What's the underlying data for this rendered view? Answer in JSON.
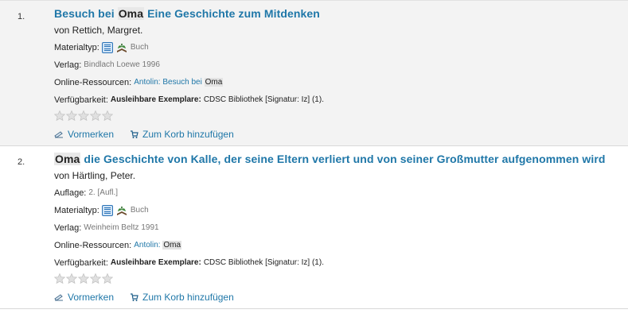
{
  "results": [
    {
      "number": "1.",
      "title_pre": "Besuch bei ",
      "title_hl": "Oma",
      "title_post": " Eine Geschichte zum Mitdenken",
      "author": "von Rettich, Margret.",
      "material_label": "Materialtyp:",
      "material_value": "Buch",
      "publisher_label": "Verlag:",
      "publisher_value": "Bindlach Loewe 1996",
      "online_label": "Online-Ressourcen:",
      "online_link": "Antolin: Besuch bei",
      "online_hl": "Oma",
      "avail_label": "Verfügbarkeit:",
      "avail_bold": "Ausleihbare Exemplare:",
      "avail_value": "CDSC Bibliothek [Signatur: Iz] (1).",
      "reserve_label": "Vormerken",
      "cart_label": "Zum Korb hinzufügen"
    },
    {
      "number": "2.",
      "title_hl": "Oma",
      "title_post": " die Geschichte von Kalle, der seine Eltern verliert und von seiner Großmutter aufgenommen wird",
      "author": "von Härtling, Peter.",
      "edition_label": "Auflage:",
      "edition_value": "2. [Aufl.]",
      "material_label": "Materialtyp:",
      "material_value": "Buch",
      "publisher_label": "Verlag:",
      "publisher_value": "Weinheim Beltz 1991",
      "online_label": "Online-Ressourcen:",
      "online_link": "Antolin:",
      "online_hl": "Oma",
      "avail_label": "Verfügbarkeit:",
      "avail_bold": "Ausleihbare Exemplare:",
      "avail_value": "CDSC Bibliothek [Signatur: Iz] (1).",
      "reserve_label": "Vormerken",
      "cart_label": "Zum Korb hinzufügen"
    }
  ],
  "icons": {
    "material": "material-type-icon",
    "book": "book-icon",
    "star": "rating-star-icon",
    "reserve": "reserve-icon",
    "cart": "cart-icon"
  },
  "colors": {
    "link": "#1f77a8",
    "highlight": "#e3e3e3",
    "odd_row": "#f3f3f3"
  }
}
